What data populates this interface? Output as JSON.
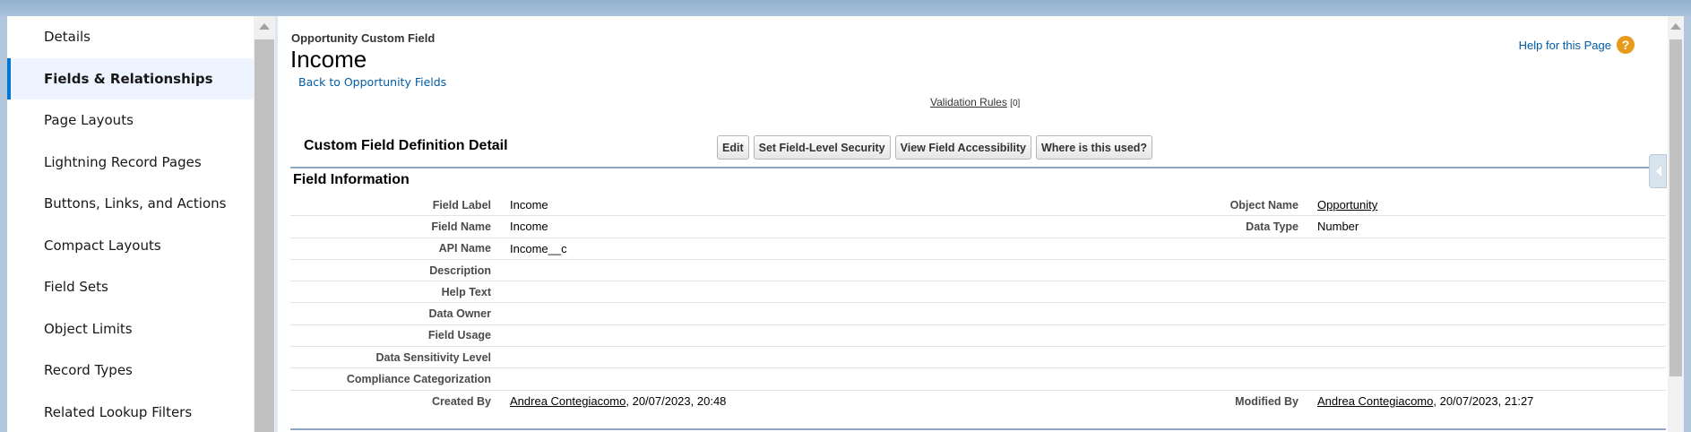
{
  "sidebar": {
    "items": [
      {
        "label": "Details"
      },
      {
        "label": "Fields & Relationships"
      },
      {
        "label": "Page Layouts"
      },
      {
        "label": "Lightning Record Pages"
      },
      {
        "label": "Buttons, Links, and Actions"
      },
      {
        "label": "Compact Layouts"
      },
      {
        "label": "Field Sets"
      },
      {
        "label": "Object Limits"
      },
      {
        "label": "Record Types"
      },
      {
        "label": "Related Lookup Filters"
      }
    ],
    "active_index": 1
  },
  "header": {
    "page_type": "Opportunity Custom Field",
    "title": "Income",
    "back_link": "Back to Opportunity Fields",
    "help_link": "Help for this Page",
    "help_icon": "?"
  },
  "validation": {
    "label": "Validation Rules",
    "count": "[0]"
  },
  "detail": {
    "section_title": "Custom Field Definition Detail",
    "buttons": {
      "edit": "Edit",
      "field_level_security": "Set Field-Level Security",
      "field_accessibility": "View Field Accessibility",
      "where_used": "Where is this used?"
    },
    "info_title": "Field Information",
    "rows": {
      "field_label": {
        "label": "Field Label",
        "value": "Income",
        "label2": "Object Name",
        "value2": "Opportunity"
      },
      "field_name": {
        "label": "Field Name",
        "value": "Income",
        "label2": "Data Type",
        "value2": "Number"
      },
      "api_name": {
        "label": "API Name",
        "value": "Income__c"
      },
      "description": {
        "label": "Description",
        "value": ""
      },
      "help_text": {
        "label": "Help Text",
        "value": ""
      },
      "data_owner": {
        "label": "Data Owner",
        "value": ""
      },
      "field_usage": {
        "label": "Field Usage",
        "value": ""
      },
      "data_sensitivity": {
        "label": "Data Sensitivity Level",
        "value": ""
      },
      "compliance": {
        "label": "Compliance Categorization",
        "value": ""
      },
      "created_by": {
        "label": "Created By",
        "user": "Andrea Contegiacomo",
        "date": ", 20/07/2023, 20:48",
        "label2": "Modified By",
        "user2": "Andrea Contegiacomo",
        "date2": ", 20/07/2023, 21:27"
      }
    }
  },
  "colors": {
    "link": "#015ba7",
    "active_accent": "#0176d3",
    "help_icon": "#e89a1b"
  }
}
